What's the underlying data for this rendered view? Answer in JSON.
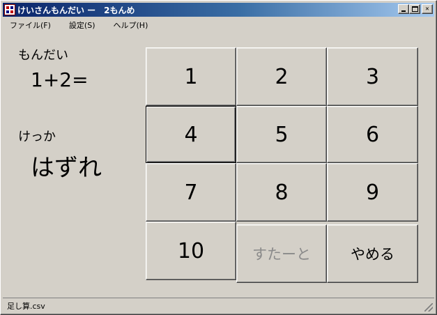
{
  "window": {
    "title": "けいさんもんだい ー　2もんめ",
    "minimize_icon": "minimize-icon",
    "maximize_icon": "maximize-icon",
    "close_glyph": "✕"
  },
  "menu": {
    "items": [
      "ファイル(F)",
      "設定(S)",
      "ヘルプ(H)"
    ]
  },
  "problem": {
    "label": "もんだい",
    "expression": "1+2="
  },
  "result": {
    "label": "けっか",
    "value": "はずれ"
  },
  "keypad": {
    "numbers": [
      "1",
      "2",
      "3",
      "4",
      "5",
      "6",
      "7",
      "8",
      "9",
      "10"
    ],
    "focused_key": "4",
    "start_label": "すたーと",
    "start_enabled": false,
    "quit_label": "やめる"
  },
  "status": {
    "filename": "足し算.csv"
  }
}
